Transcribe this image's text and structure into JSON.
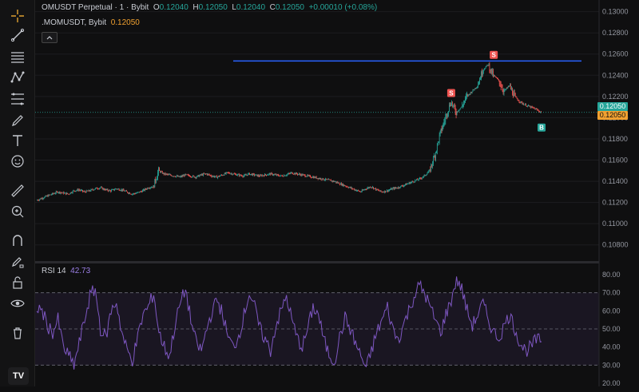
{
  "legend": {
    "symbol": "OMUSDT Perpetual · 1 · Bybit",
    "o_label": "O",
    "o_value": "0.12040",
    "h_label": "H",
    "h_value": "0.12050",
    "l_label": "L",
    "l_value": "0.12040",
    "c_label": "C",
    "c_value": "0.12050",
    "change": "+0.00010 (+0.08%)",
    "overlay_symbol": ".MOMUSDT, Bybit",
    "overlay_value": "0.12050",
    "rsi_label": "RSI 14",
    "rsi_value": "42.73"
  },
  "price_tags": {
    "green": "0.12050",
    "orange": "0.12050"
  },
  "tv_logo": "TV",
  "colors": {
    "up": "#26a69a",
    "down": "#ef5350",
    "hline": "#2962ff",
    "rsi": "#7e57c2",
    "tag_green": "#26a69a",
    "tag_orange": "#f0a030"
  },
  "chart_data": [
    {
      "type": "candlestick",
      "title": "OMUSDT Perpetual · 1 · Bybit",
      "yticks": [
        "0.13000",
        "0.12800",
        "0.12600",
        "0.12400",
        "0.12200",
        "0.12000",
        "0.11800",
        "0.11600",
        "0.11400",
        "0.11200",
        "0.11000",
        "0.10800"
      ],
      "ylim": [
        0.107,
        0.1305
      ],
      "horizontal_line": 0.12535,
      "close_path": [
        0.1122,
        0.1124,
        0.1126,
        0.1128,
        0.113,
        0.1129,
        0.1128,
        0.1131,
        0.1132,
        0.113,
        0.1131,
        0.1133,
        0.1134,
        0.1132,
        0.1131,
        0.1133,
        0.1132,
        0.113,
        0.1128,
        0.1129,
        0.1131,
        0.1134,
        0.1135,
        0.115,
        0.1147,
        0.1146,
        0.1145,
        0.1144,
        0.1146,
        0.1145,
        0.1144,
        0.1146,
        0.1147,
        0.1145,
        0.1144,
        0.1146,
        0.1148,
        0.1147,
        0.1146,
        0.1145,
        0.1147,
        0.1146,
        0.1145,
        0.1146,
        0.1147,
        0.1146,
        0.1145,
        0.1146,
        0.1148,
        0.1147,
        0.1146,
        0.1145,
        0.1144,
        0.1143,
        0.1142,
        0.1141,
        0.114,
        0.1138,
        0.1136,
        0.1134,
        0.1132,
        0.113,
        0.1133,
        0.1135,
        0.1132,
        0.113,
        0.1131,
        0.1133,
        0.1134,
        0.1136,
        0.1138,
        0.114,
        0.1142,
        0.1145,
        0.115,
        0.1165,
        0.1185,
        0.12,
        0.1215,
        0.1205,
        0.121,
        0.122,
        0.1225,
        0.123,
        0.1245,
        0.125,
        0.124,
        0.1235,
        0.1225,
        0.123,
        0.122,
        0.1215,
        0.1212,
        0.121,
        0.1208,
        0.1205
      ],
      "signals": [
        {
          "label": "S",
          "index": 86,
          "price": 0.1254,
          "kind": "sell"
        },
        {
          "label": "S",
          "index": 78,
          "price": 0.1218,
          "kind": "sell"
        },
        {
          "label": "B",
          "index": 95,
          "price": 0.1196,
          "kind": "buy"
        }
      ]
    },
    {
      "type": "line",
      "title": "RSI 14",
      "yticks": [
        "80.00",
        "70.00",
        "60.00",
        "50.00",
        "40.00",
        "30.00",
        "20.00"
      ],
      "ylim": [
        20,
        80
      ],
      "bands": [
        30,
        50,
        70
      ],
      "values": [
        62,
        60,
        52,
        48,
        55,
        40,
        35,
        30,
        42,
        55,
        68,
        72,
        50,
        45,
        60,
        65,
        48,
        38,
        33,
        45,
        58,
        62,
        70,
        48,
        40,
        35,
        52,
        64,
        72,
        55,
        42,
        38,
        50,
        60,
        66,
        58,
        45,
        40,
        46,
        58,
        70,
        62,
        50,
        44,
        38,
        52,
        60,
        68,
        55,
        45,
        40,
        50,
        62,
        58,
        44,
        36,
        32,
        45,
        56,
        50,
        42,
        35,
        28,
        38,
        48,
        55,
        62,
        50,
        44,
        52,
        60,
        68,
        74,
        70,
        62,
        55,
        48,
        58,
        66,
        78,
        72,
        60,
        52,
        58,
        64,
        55,
        48,
        45,
        52,
        58,
        50,
        42,
        38,
        40,
        44,
        43
      ]
    }
  ]
}
